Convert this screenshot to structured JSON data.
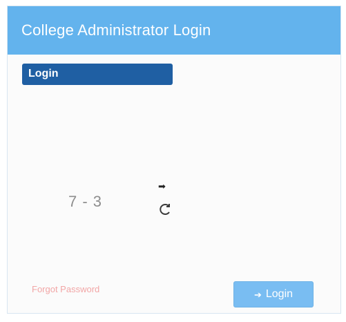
{
  "panel": {
    "title": "College Administrator Login",
    "badge_label": "Login"
  },
  "form": {
    "username_placeholder": "",
    "password_placeholder": "",
    "captcha_text": "7 - 3",
    "captcha_input_placeholder": "",
    "forgot_label": "Forgot Password",
    "login_label": "Login"
  },
  "icons": {
    "arrow": "small-black-arrow",
    "refresh": "refresh-icon",
    "login": "sign-in-icon"
  },
  "colors": {
    "header": "#63b3ed",
    "badge": "#1f5fa3",
    "button": "#79bdf2",
    "link": "#f2a6a6"
  }
}
